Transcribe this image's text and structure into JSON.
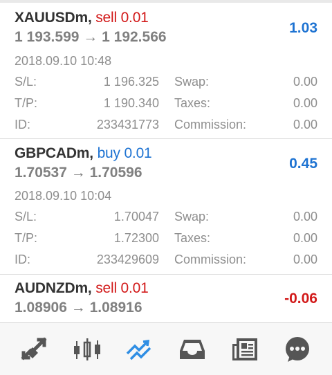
{
  "positions": [
    {
      "symbol": "XAUUSDm,",
      "direction": "sell 0.01",
      "open_price": "1 193.599",
      "arrow": "→",
      "current_price": "1 192.566",
      "profit": "1.03",
      "datetime": "2018.09.10 10:48",
      "sl_label": "S/L:",
      "sl_value": "1 196.325",
      "tp_label": "T/P:",
      "tp_value": "1 190.340",
      "id_label": "ID:",
      "id_value": "233431773",
      "swap_label": "Swap:",
      "swap_value": "0.00",
      "taxes_label": "Taxes:",
      "taxes_value": "0.00",
      "commission_label": "Commission:",
      "commission_value": "0.00"
    },
    {
      "symbol": "GBPCADm,",
      "direction": "buy 0.01",
      "open_price": "1.70537",
      "arrow": "→",
      "current_price": "1.70596",
      "profit": "0.45",
      "datetime": "2018.09.10 10:04",
      "sl_label": "S/L:",
      "sl_value": "1.70047",
      "tp_label": "T/P:",
      "tp_value": "1.72300",
      "id_label": "ID:",
      "id_value": "233429609",
      "swap_label": "Swap:",
      "swap_value": "0.00",
      "taxes_label": "Taxes:",
      "taxes_value": "0.00",
      "commission_label": "Commission:",
      "commission_value": "0.00"
    },
    {
      "symbol": "AUDNZDm,",
      "direction": "sell 0.01",
      "open_price": "1.08906",
      "arrow": "→",
      "current_price": "1.08916",
      "profit": "-0.06"
    }
  ],
  "toolbar": {
    "items": [
      {
        "icon": "quotes-arrows-icon",
        "active": false
      },
      {
        "icon": "candlestick-chart-icon",
        "active": false
      },
      {
        "icon": "trade-icon",
        "active": true
      },
      {
        "icon": "history-inbox-icon",
        "active": false
      },
      {
        "icon": "news-icon",
        "active": false
      },
      {
        "icon": "messages-icon",
        "active": false
      }
    ]
  },
  "colors": {
    "sell": "#d21919",
    "buy": "#1e73d2",
    "profit_positive": "#1e73d2",
    "profit_negative": "#d21919",
    "active_icon": "#2f8ee4",
    "icon": "#555555"
  }
}
